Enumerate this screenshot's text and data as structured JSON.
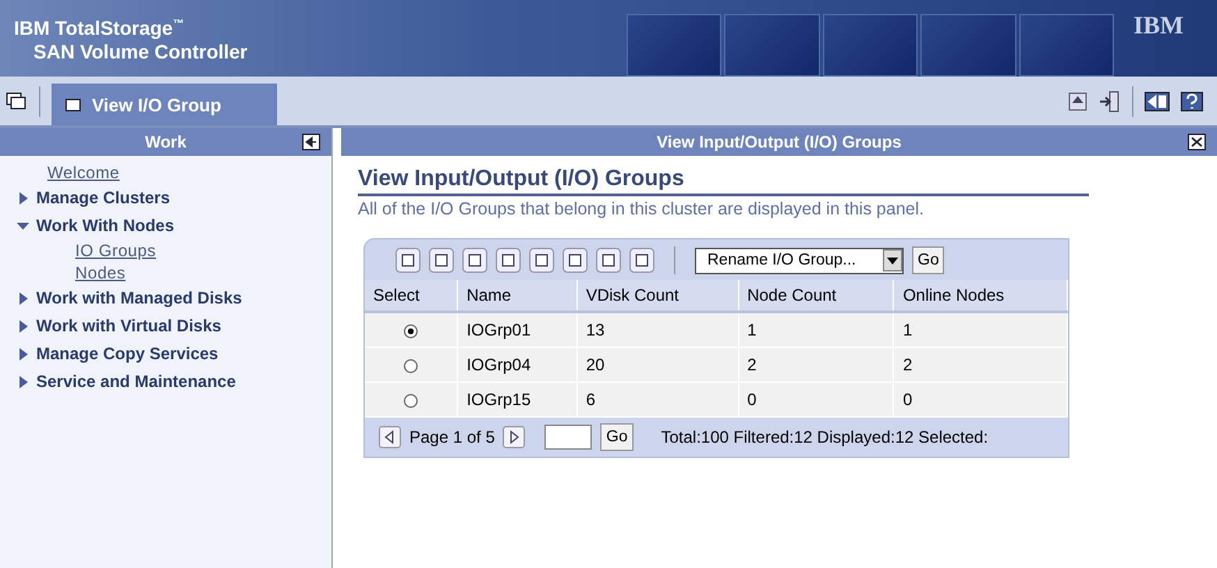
{
  "header": {
    "brand": "IBM TotalStorage",
    "trademark": "™",
    "product": "SAN Volume Controller",
    "logo": "IBM"
  },
  "tabbar": {
    "tab": "View I/O Group"
  },
  "sidebar": {
    "title": "Work",
    "items": [
      {
        "label": "Welcome",
        "kind": "link"
      },
      {
        "label": "Manage Clusters",
        "kind": "section",
        "expanded": false
      },
      {
        "label": "Work With Nodes",
        "kind": "section",
        "expanded": true,
        "children": [
          {
            "label": "IO Groups",
            "kind": "link"
          },
          {
            "label": "Nodes",
            "kind": "link"
          }
        ]
      },
      {
        "label": "Work with Managed Disks",
        "kind": "section",
        "expanded": false
      },
      {
        "label": "Work with Virtual Disks",
        "kind": "section",
        "expanded": false
      },
      {
        "label": "Manage Copy Services",
        "kind": "section",
        "expanded": false
      },
      {
        "label": "Service and Maintenance",
        "kind": "section",
        "expanded": false
      }
    ]
  },
  "panel": {
    "title": "View Input/Output (I/O) Groups",
    "heading": "View Input/Output (I/O) Groups",
    "description": "All of the I/O Groups that belong in this cluster are displayed in this panel.",
    "action_select": "Rename I/O Group...",
    "go_button": "Go",
    "table": {
      "columns": [
        "Select",
        "Name",
        "VDisk Count",
        "Node Count",
        "Online Nodes"
      ],
      "rows": [
        {
          "selected": true,
          "cells": [
            "",
            "IOGrp01",
            "13",
            "1",
            "1"
          ]
        },
        {
          "selected": false,
          "cells": [
            "",
            "IOGrp04",
            "20",
            "2",
            "2"
          ]
        },
        {
          "selected": false,
          "cells": [
            "",
            "IOGrp15",
            "6",
            "0",
            "0"
          ]
        }
      ]
    },
    "pager": {
      "page": "Page 1 of 5",
      "go_button": "Go",
      "summary": "Total:100 Filtered:12 Displayed:12 Selected:"
    }
  }
}
